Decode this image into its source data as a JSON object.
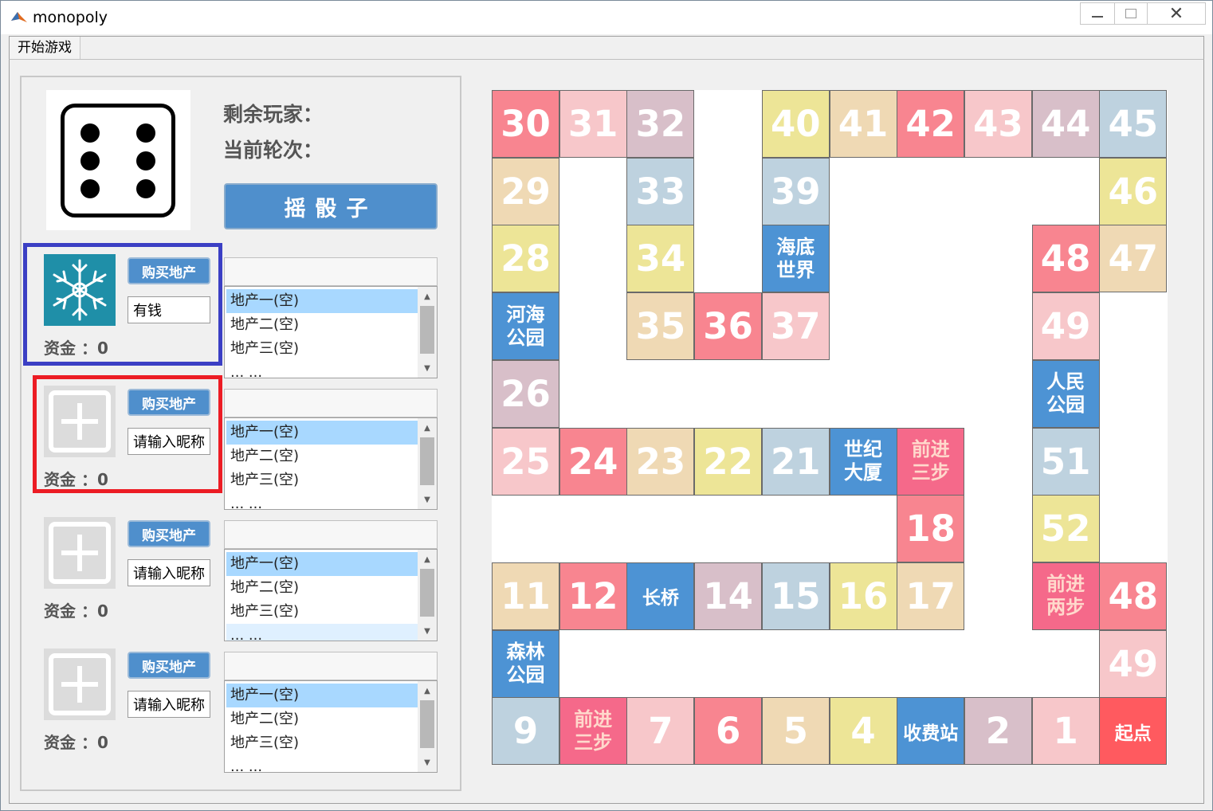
{
  "window": {
    "title": "monopoly"
  },
  "menu": {
    "start_game": "开始游戏"
  },
  "status": {
    "remaining_players": "剩余玩家：",
    "current_turn": "当前轮次："
  },
  "roll_button": "摇骰子",
  "dice_value": 6,
  "players": [
    {
      "name": "有钱",
      "placeholder": "请输入昵称",
      "buy_label": "购买地产",
      "funds_label": "资金 ：0",
      "avatar": "snowflake-icon",
      "properties": [
        "地产一(空)",
        "地产二(空)",
        "地产三(空)",
        "... ..."
      ]
    },
    {
      "name": "请输入昵称",
      "placeholder": "请输入昵称",
      "buy_label": "购买地产",
      "funds_label": "资金 ：0",
      "avatar": "plus-icon",
      "properties": [
        "地产一(空)",
        "地产二(空)",
        "地产三(空)",
        "... ..."
      ]
    },
    {
      "name": "请输入昵称",
      "placeholder": "请输入昵称",
      "buy_label": "购买地产",
      "funds_label": "资金 ：0",
      "avatar": "plus-icon",
      "properties": [
        "地产一(空)",
        "地产二(空)",
        "地产三(空)",
        "... ..."
      ]
    },
    {
      "name": "请输入昵称",
      "placeholder": "请输入昵称",
      "buy_label": "购买地产",
      "funds_label": "资金 ：0",
      "avatar": "plus-icon",
      "properties": [
        "地产一(空)",
        "地产二(空)",
        "地产三(空)",
        "... ..."
      ]
    }
  ],
  "colors": {
    "red": "#f88590",
    "pink": "#f7c7ca",
    "mauve": "#d8bfc9",
    "tan": "#efd9b4",
    "yellow": "#ede597",
    "steel": "#bed2df",
    "blue": "#4d93d4",
    "hotpink": "#f5698a",
    "start": "#ff5a5f",
    "player1_frame": "#3b3fc4",
    "player2_frame": "#ec1c24"
  },
  "board": {
    "cells": [
      [
        "30",
        "red",
        0,
        0
      ],
      [
        "31",
        "pink",
        1,
        0
      ],
      [
        "32",
        "mauve",
        2,
        0
      ],
      [
        "40",
        "yellow",
        4,
        0
      ],
      [
        "41",
        "tan",
        5,
        0
      ],
      [
        "42",
        "red",
        6,
        0
      ],
      [
        "43",
        "pink",
        7,
        0
      ],
      [
        "44",
        "mauve",
        8,
        0
      ],
      [
        "45",
        "steel",
        9,
        0
      ],
      [
        "29",
        "tan",
        0,
        1
      ],
      [
        "33",
        "steel",
        2,
        1
      ],
      [
        "39",
        "steel",
        4,
        1
      ],
      [
        "46",
        "yellow",
        9,
        1
      ],
      [
        "28",
        "yellow",
        0,
        2
      ],
      [
        "34",
        "yellow",
        2,
        2
      ],
      [
        "海底\n世界",
        "blue",
        4,
        2
      ],
      [
        "48",
        "red",
        8,
        2
      ],
      [
        "47",
        "tan",
        9,
        2
      ],
      [
        "河海\n公园",
        "blue",
        0,
        3
      ],
      [
        "35",
        "tan",
        2,
        3
      ],
      [
        "36",
        "red",
        3,
        3
      ],
      [
        "37",
        "pink",
        4,
        3
      ],
      [
        "49",
        "pink",
        8,
        3
      ],
      [
        "26",
        "mauve",
        0,
        4
      ],
      [
        "人民\n公园",
        "blue",
        8,
        4
      ],
      [
        "25",
        "pink",
        0,
        5
      ],
      [
        "24",
        "red",
        1,
        5
      ],
      [
        "23",
        "tan",
        2,
        5
      ],
      [
        "22",
        "yellow",
        3,
        5
      ],
      [
        "21",
        "steel",
        4,
        5
      ],
      [
        "世纪\n大厦",
        "blue",
        5,
        5
      ],
      [
        "前进\n三步",
        "hotpink",
        6,
        5
      ],
      [
        "51",
        "steel",
        8,
        5
      ],
      [
        "18",
        "red",
        6,
        6
      ],
      [
        "52",
        "yellow",
        8,
        6
      ],
      [
        "11",
        "tan",
        0,
        7
      ],
      [
        "12",
        "red",
        1,
        7
      ],
      [
        "长桥",
        "blue",
        2,
        7
      ],
      [
        "14",
        "mauve",
        3,
        7
      ],
      [
        "15",
        "steel",
        4,
        7
      ],
      [
        "16",
        "yellow",
        5,
        7
      ],
      [
        "17",
        "tan",
        6,
        7
      ],
      [
        "前进\n两步",
        "hotpink",
        8,
        7
      ],
      [
        "48",
        "red",
        9,
        7
      ],
      [
        "森林\n公园",
        "blue",
        0,
        8
      ],
      [
        "49",
        "pink",
        9,
        8
      ],
      [
        "9",
        "steel",
        0,
        9
      ],
      [
        "前进\n三步",
        "hotpink",
        1,
        9
      ],
      [
        "7",
        "pink",
        2,
        9
      ],
      [
        "6",
        "red",
        3,
        9
      ],
      [
        "5",
        "tan",
        4,
        9
      ],
      [
        "4",
        "yellow",
        5,
        9
      ],
      [
        "收费站",
        "blue",
        6,
        9
      ],
      [
        "2",
        "mauve",
        7,
        9
      ],
      [
        "1",
        "pink",
        8,
        9
      ],
      [
        "起点",
        "start",
        9,
        9
      ]
    ]
  }
}
